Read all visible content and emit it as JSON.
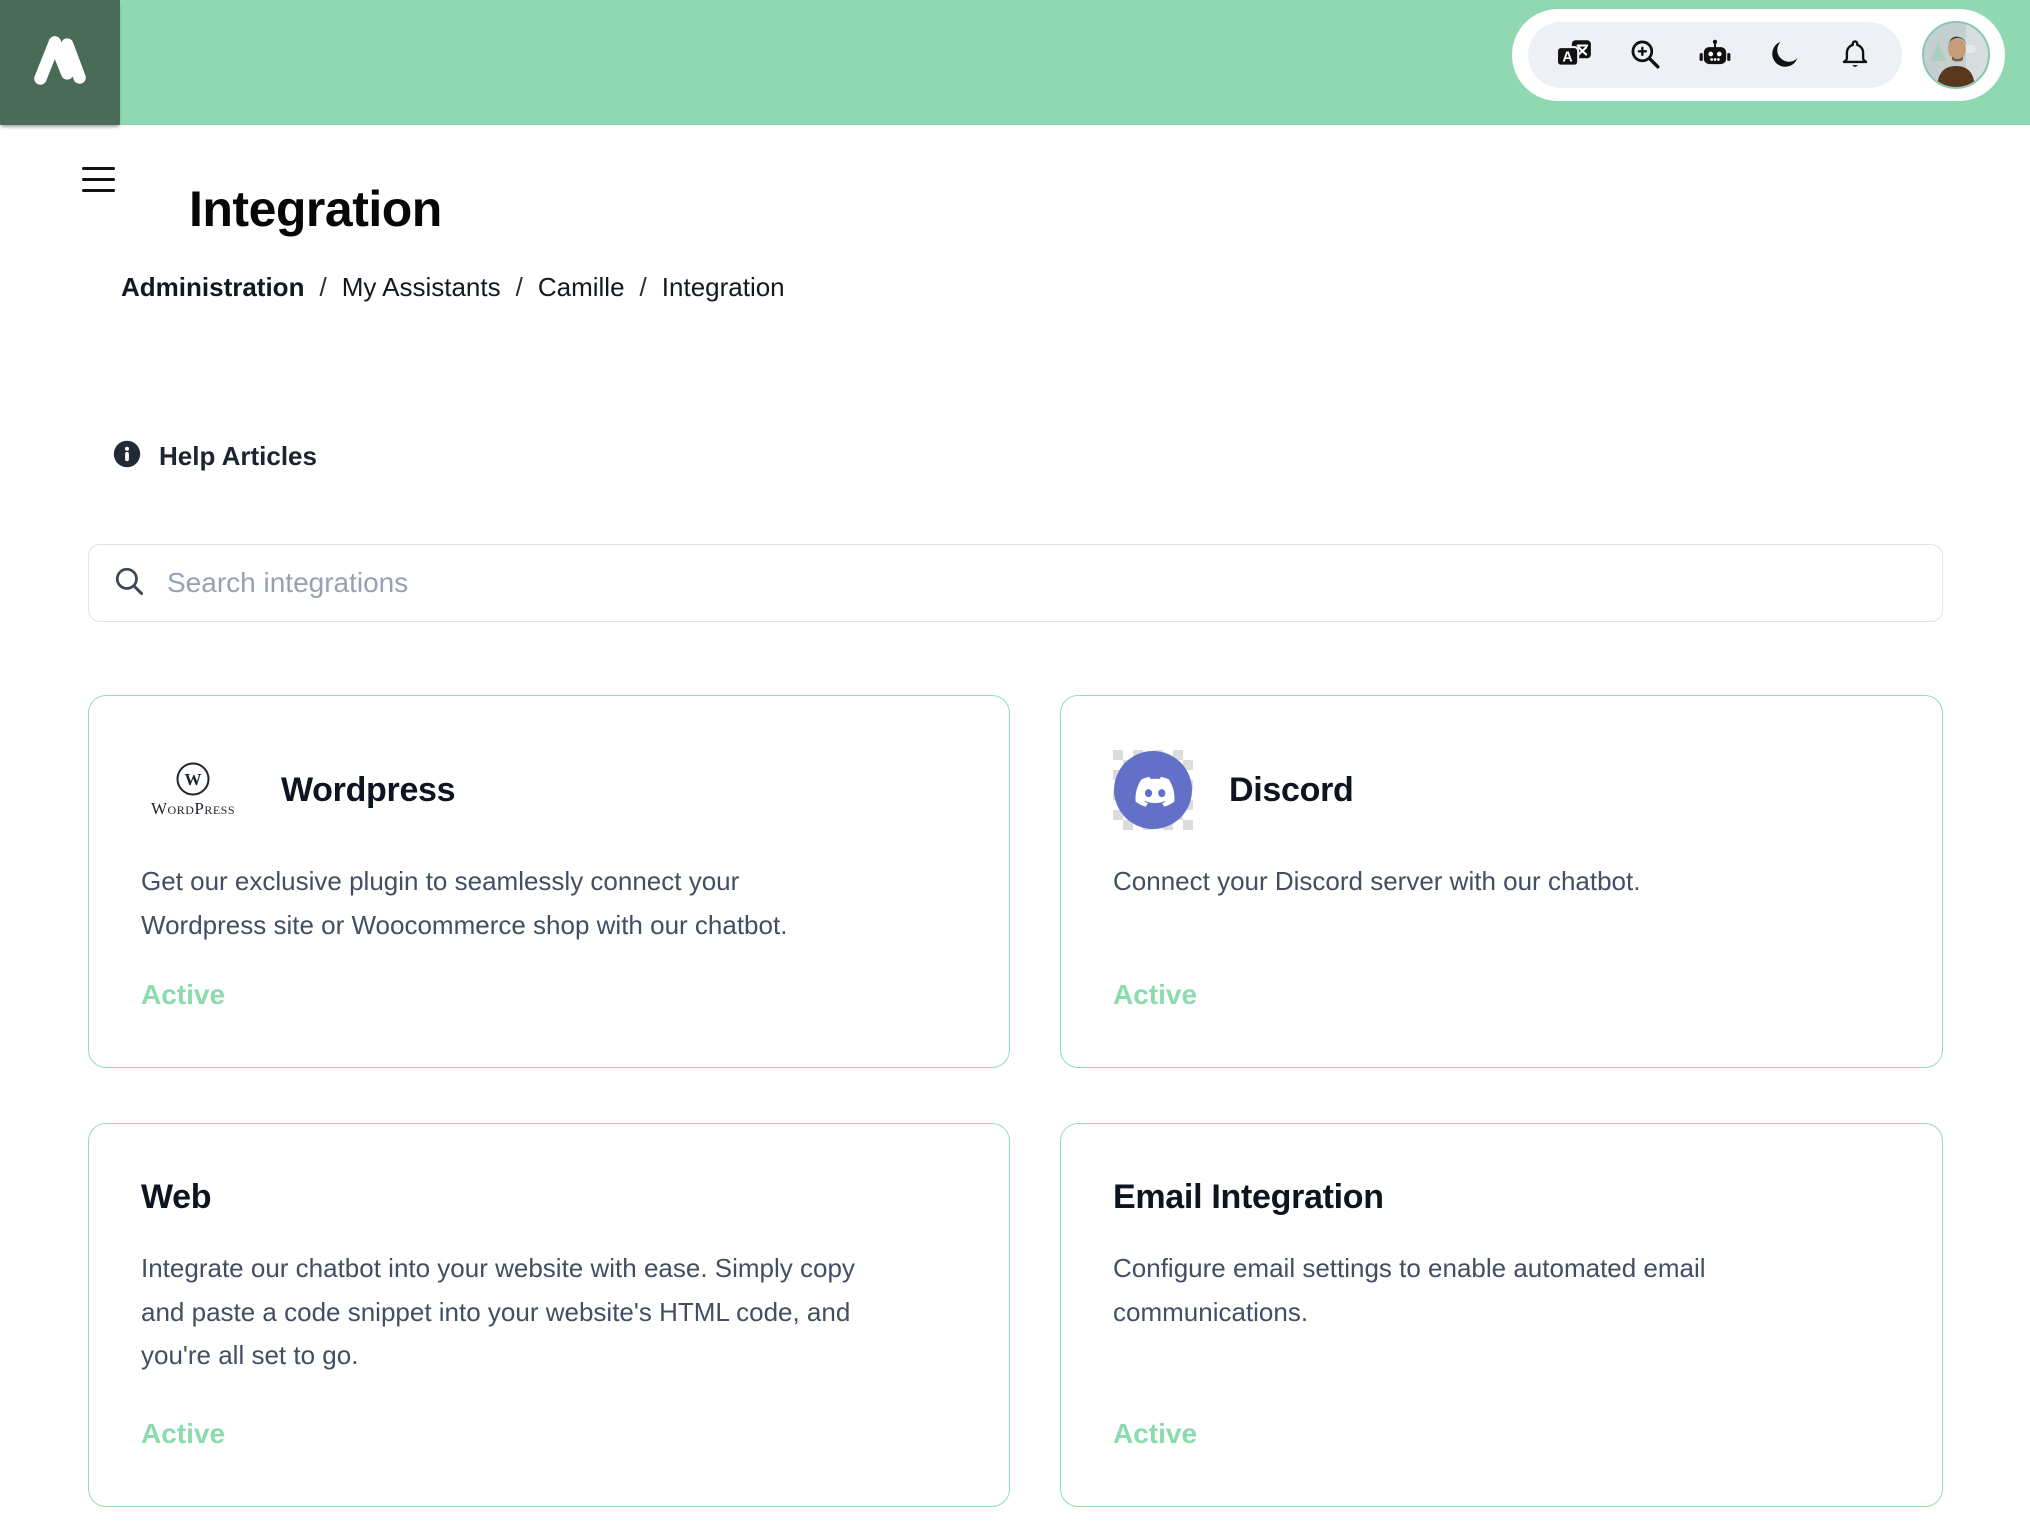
{
  "page_title": "Integration",
  "breadcrumb": {
    "separator": "/",
    "items": [
      "Administration",
      "My Assistants",
      "Camille",
      "Integration"
    ]
  },
  "help_articles": {
    "label": "Help Articles"
  },
  "search": {
    "placeholder": "Search integrations",
    "value": ""
  },
  "toolbar": {
    "icons": [
      "translate-icon",
      "zoom-in-icon",
      "robot-icon",
      "moon-icon",
      "bell-icon"
    ],
    "translate_letter": "A"
  },
  "logos": {
    "wordpress_monogram": "W",
    "wordpress_text": "WordPress"
  },
  "cards": [
    {
      "id": "wordpress",
      "title": "Wordpress",
      "description": "Get our exclusive plugin to seamlessly connect your Wordpress site or Woocommerce shop with our chatbot.",
      "status": "Active"
    },
    {
      "id": "discord",
      "title": "Discord",
      "description": "Connect your Discord server with our chatbot.",
      "status": "Active"
    },
    {
      "id": "web",
      "title": "Web",
      "description": "Integrate our chatbot into your website with ease. Simply copy and paste a code snippet into your website's HTML code, and you're all set to go.",
      "status": "Active"
    },
    {
      "id": "email",
      "title": "Email Integration",
      "description": "Configure email settings to enable automated email communications.",
      "status": "Active"
    }
  ],
  "colors": {
    "header_green": "#90d8b2",
    "logo_dark_green": "#4a6b58",
    "card_border_green": "#92dfb4",
    "active_green": "#8adcac",
    "discord_blurple": "#6370c8"
  }
}
